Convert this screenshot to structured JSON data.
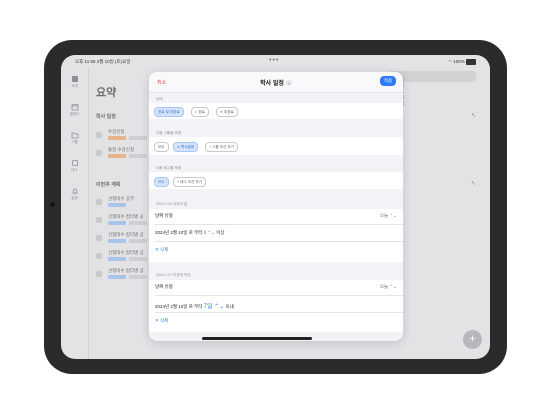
{
  "status": {
    "time": "오후 11:55",
    "date": "2월 10일 (토)요일",
    "battery": "100%"
  },
  "sidebar": [
    {
      "icon": "summary-icon",
      "label": "요약"
    },
    {
      "icon": "calendar-icon",
      "label": "캘린더"
    },
    {
      "icon": "folder-icon",
      "label": "그룹"
    },
    {
      "icon": "tag-icon",
      "label": "태그"
    },
    {
      "icon": "bell-icon",
      "label": "알림"
    }
  ],
  "background": {
    "title": "요약",
    "search_placeholder": "이벤트 검색",
    "section1": "학사 일정",
    "rows1": [
      "수강신청",
      "통합 수강신청"
    ],
    "section2": "이번주 계획",
    "rows2": [
      "선형대수 공부",
      "선형대수 컴티벌 공",
      "선형대수 컴티벌 공",
      "선형대수 컴티벌 공",
      "선형대수 컴티벌 공"
    ]
  },
  "modal": {
    "cancel": "취소",
    "title": "학사 일정",
    "apply": "적용",
    "status_label": "상태",
    "status_chips": [
      "완료 및 미완료",
      "완료",
      "미완료"
    ],
    "group_label": "다음 그룹을 포함",
    "group_chips": [
      "모두",
      "학사일정",
      "그룹 조건 추가"
    ],
    "tag_label": "다음 태그를 포함",
    "tag_chips": [
      "모두",
      "태그 조건 추가"
    ],
    "filter1": {
      "label": "2024.2.10 이후의 일",
      "row1_left": "날짜 유형",
      "row1_right": "오늘",
      "row2_text": "2024년 2월 10일 로 부터",
      "row2_value": "0",
      "row2_suffix": "이상",
      "delete": "삭제"
    },
    "filter2": {
      "label": "2024.2.17 이전의 작업",
      "row1_left": "날짜 유형",
      "row1_right": "오늘",
      "row2_text": "2024년 2월 10일 로 부터",
      "row2_value": "7일",
      "row2_suffix": "이내",
      "delete": "삭제"
    }
  }
}
